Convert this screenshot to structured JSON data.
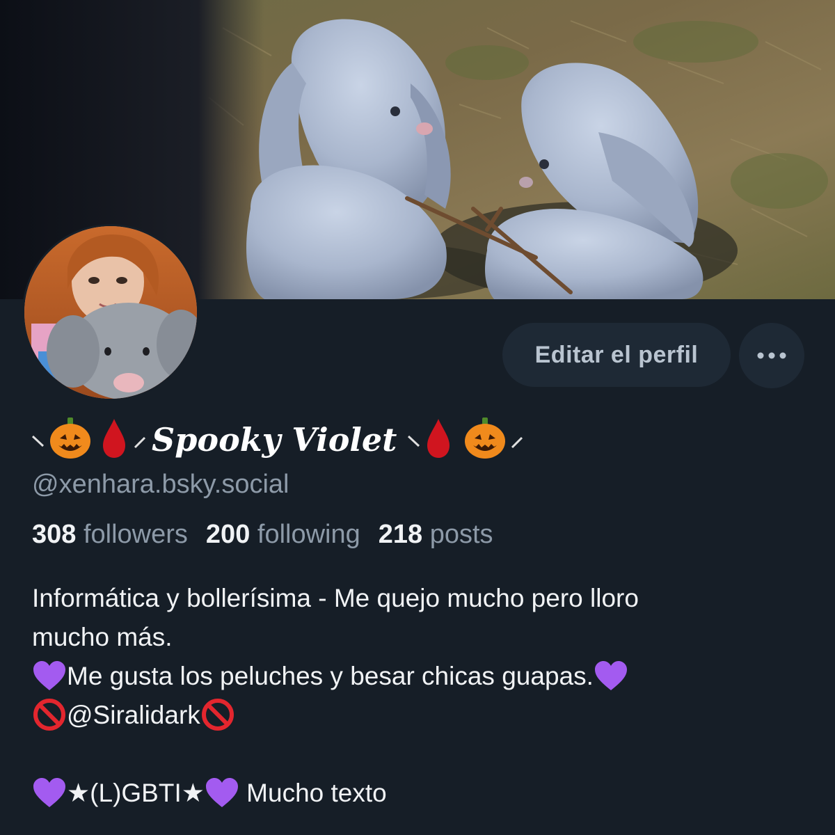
{
  "banner": {
    "description_icon": "banner-image"
  },
  "avatar": {
    "icon": "avatar-photo"
  },
  "actions": {
    "edit_label": "Editar el perfil",
    "more_icon": "ellipsis-icon"
  },
  "profile": {
    "display_name": "Spooky Violet",
    "handle": "@xenhara.bsky.social"
  },
  "stats": {
    "followers_count": "308",
    "followers_label": "followers",
    "following_count": "200",
    "following_label": "following",
    "posts_count": "218",
    "posts_label": "posts"
  },
  "bio": {
    "line1": "Informática y bollerísima - Me quejo mucho pero lloro",
    "line2": "mucho más.",
    "line3": "Me gusta los peluches y besar chicas guapas.",
    "line4": "@Siralidark",
    "line5_a": "★(L)GBTI★",
    "line5_b": " Mucho texto"
  },
  "colors": {
    "background": "#161e27",
    "button_bg": "#1e2935",
    "muted_text": "#8d9aa8",
    "primary_text": "#f1f3f5",
    "purple_heart": "#a35bf0",
    "blood_red": "#d0151f",
    "pumpkin": "#f08a1c"
  }
}
